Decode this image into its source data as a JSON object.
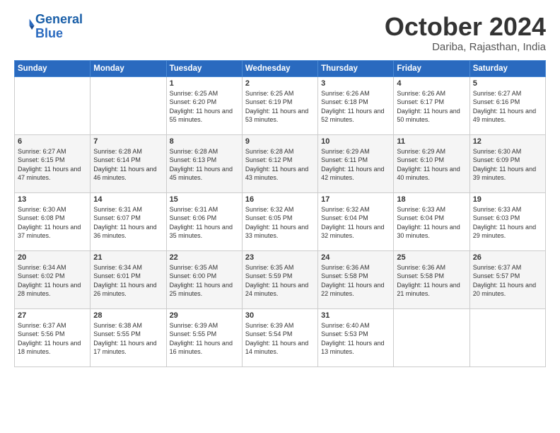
{
  "header": {
    "logo_line1": "General",
    "logo_line2": "Blue",
    "month": "October 2024",
    "location": "Dariba, Rajasthan, India"
  },
  "weekdays": [
    "Sunday",
    "Monday",
    "Tuesday",
    "Wednesday",
    "Thursday",
    "Friday",
    "Saturday"
  ],
  "weeks": [
    [
      {
        "day": "",
        "sunrise": "",
        "sunset": "",
        "daylight": ""
      },
      {
        "day": "",
        "sunrise": "",
        "sunset": "",
        "daylight": ""
      },
      {
        "day": "1",
        "sunrise": "Sunrise: 6:25 AM",
        "sunset": "Sunset: 6:20 PM",
        "daylight": "Daylight: 11 hours and 55 minutes."
      },
      {
        "day": "2",
        "sunrise": "Sunrise: 6:25 AM",
        "sunset": "Sunset: 6:19 PM",
        "daylight": "Daylight: 11 hours and 53 minutes."
      },
      {
        "day": "3",
        "sunrise": "Sunrise: 6:26 AM",
        "sunset": "Sunset: 6:18 PM",
        "daylight": "Daylight: 11 hours and 52 minutes."
      },
      {
        "day": "4",
        "sunrise": "Sunrise: 6:26 AM",
        "sunset": "Sunset: 6:17 PM",
        "daylight": "Daylight: 11 hours and 50 minutes."
      },
      {
        "day": "5",
        "sunrise": "Sunrise: 6:27 AM",
        "sunset": "Sunset: 6:16 PM",
        "daylight": "Daylight: 11 hours and 49 minutes."
      }
    ],
    [
      {
        "day": "6",
        "sunrise": "Sunrise: 6:27 AM",
        "sunset": "Sunset: 6:15 PM",
        "daylight": "Daylight: 11 hours and 47 minutes."
      },
      {
        "day": "7",
        "sunrise": "Sunrise: 6:28 AM",
        "sunset": "Sunset: 6:14 PM",
        "daylight": "Daylight: 11 hours and 46 minutes."
      },
      {
        "day": "8",
        "sunrise": "Sunrise: 6:28 AM",
        "sunset": "Sunset: 6:13 PM",
        "daylight": "Daylight: 11 hours and 45 minutes."
      },
      {
        "day": "9",
        "sunrise": "Sunrise: 6:28 AM",
        "sunset": "Sunset: 6:12 PM",
        "daylight": "Daylight: 11 hours and 43 minutes."
      },
      {
        "day": "10",
        "sunrise": "Sunrise: 6:29 AM",
        "sunset": "Sunset: 6:11 PM",
        "daylight": "Daylight: 11 hours and 42 minutes."
      },
      {
        "day": "11",
        "sunrise": "Sunrise: 6:29 AM",
        "sunset": "Sunset: 6:10 PM",
        "daylight": "Daylight: 11 hours and 40 minutes."
      },
      {
        "day": "12",
        "sunrise": "Sunrise: 6:30 AM",
        "sunset": "Sunset: 6:09 PM",
        "daylight": "Daylight: 11 hours and 39 minutes."
      }
    ],
    [
      {
        "day": "13",
        "sunrise": "Sunrise: 6:30 AM",
        "sunset": "Sunset: 6:08 PM",
        "daylight": "Daylight: 11 hours and 37 minutes."
      },
      {
        "day": "14",
        "sunrise": "Sunrise: 6:31 AM",
        "sunset": "Sunset: 6:07 PM",
        "daylight": "Daylight: 11 hours and 36 minutes."
      },
      {
        "day": "15",
        "sunrise": "Sunrise: 6:31 AM",
        "sunset": "Sunset: 6:06 PM",
        "daylight": "Daylight: 11 hours and 35 minutes."
      },
      {
        "day": "16",
        "sunrise": "Sunrise: 6:32 AM",
        "sunset": "Sunset: 6:05 PM",
        "daylight": "Daylight: 11 hours and 33 minutes."
      },
      {
        "day": "17",
        "sunrise": "Sunrise: 6:32 AM",
        "sunset": "Sunset: 6:04 PM",
        "daylight": "Daylight: 11 hours and 32 minutes."
      },
      {
        "day": "18",
        "sunrise": "Sunrise: 6:33 AM",
        "sunset": "Sunset: 6:04 PM",
        "daylight": "Daylight: 11 hours and 30 minutes."
      },
      {
        "day": "19",
        "sunrise": "Sunrise: 6:33 AM",
        "sunset": "Sunset: 6:03 PM",
        "daylight": "Daylight: 11 hours and 29 minutes."
      }
    ],
    [
      {
        "day": "20",
        "sunrise": "Sunrise: 6:34 AM",
        "sunset": "Sunset: 6:02 PM",
        "daylight": "Daylight: 11 hours and 28 minutes."
      },
      {
        "day": "21",
        "sunrise": "Sunrise: 6:34 AM",
        "sunset": "Sunset: 6:01 PM",
        "daylight": "Daylight: 11 hours and 26 minutes."
      },
      {
        "day": "22",
        "sunrise": "Sunrise: 6:35 AM",
        "sunset": "Sunset: 6:00 PM",
        "daylight": "Daylight: 11 hours and 25 minutes."
      },
      {
        "day": "23",
        "sunrise": "Sunrise: 6:35 AM",
        "sunset": "Sunset: 5:59 PM",
        "daylight": "Daylight: 11 hours and 24 minutes."
      },
      {
        "day": "24",
        "sunrise": "Sunrise: 6:36 AM",
        "sunset": "Sunset: 5:58 PM",
        "daylight": "Daylight: 11 hours and 22 minutes."
      },
      {
        "day": "25",
        "sunrise": "Sunrise: 6:36 AM",
        "sunset": "Sunset: 5:58 PM",
        "daylight": "Daylight: 11 hours and 21 minutes."
      },
      {
        "day": "26",
        "sunrise": "Sunrise: 6:37 AM",
        "sunset": "Sunset: 5:57 PM",
        "daylight": "Daylight: 11 hours and 20 minutes."
      }
    ],
    [
      {
        "day": "27",
        "sunrise": "Sunrise: 6:37 AM",
        "sunset": "Sunset: 5:56 PM",
        "daylight": "Daylight: 11 hours and 18 minutes."
      },
      {
        "day": "28",
        "sunrise": "Sunrise: 6:38 AM",
        "sunset": "Sunset: 5:55 PM",
        "daylight": "Daylight: 11 hours and 17 minutes."
      },
      {
        "day": "29",
        "sunrise": "Sunrise: 6:39 AM",
        "sunset": "Sunset: 5:55 PM",
        "daylight": "Daylight: 11 hours and 16 minutes."
      },
      {
        "day": "30",
        "sunrise": "Sunrise: 6:39 AM",
        "sunset": "Sunset: 5:54 PM",
        "daylight": "Daylight: 11 hours and 14 minutes."
      },
      {
        "day": "31",
        "sunrise": "Sunrise: 6:40 AM",
        "sunset": "Sunset: 5:53 PM",
        "daylight": "Daylight: 11 hours and 13 minutes."
      },
      {
        "day": "",
        "sunrise": "",
        "sunset": "",
        "daylight": ""
      },
      {
        "day": "",
        "sunrise": "",
        "sunset": "",
        "daylight": ""
      }
    ]
  ]
}
